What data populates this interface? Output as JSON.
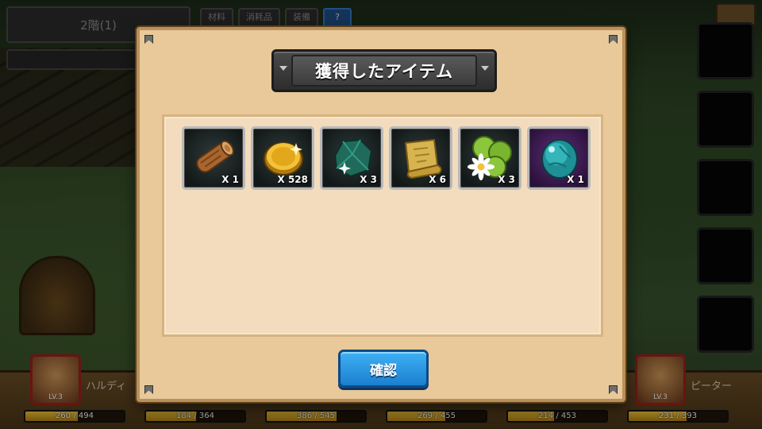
{
  "background": {
    "floor_label": "2階(1)",
    "tabs": [
      "材料",
      "消耗品",
      "装備",
      "?"
    ],
    "heroes": [
      {
        "name": "ハルディ",
        "level": "LV.3"
      },
      {
        "name": "ピーター",
        "level": "LV.3"
      }
    ],
    "hp_bars": [
      {
        "text": "260 / 494",
        "fill": 0.53
      },
      {
        "text": "184 / 364",
        "fill": 0.51
      },
      {
        "text": "386 / 545",
        "fill": 0.71
      },
      {
        "text": "269 / 455",
        "fill": 0.59
      },
      {
        "text": "214 / 453",
        "fill": 0.47
      },
      {
        "text": "231 / 393",
        "fill": 0.59
      }
    ]
  },
  "dialog": {
    "title": "獲得したアイテム",
    "items": [
      {
        "icon": "wood-log-icon",
        "quantity": "X 1"
      },
      {
        "icon": "gold-coin-icon",
        "quantity": "X 528"
      },
      {
        "icon": "green-crystal-ore-icon",
        "quantity": "X 3"
      },
      {
        "icon": "parchment-scroll-icon",
        "quantity": "X 6"
      },
      {
        "icon": "daisy-leaf-icon",
        "quantity": "X 3"
      },
      {
        "icon": "teal-egg-gem-icon",
        "quantity": "X 1"
      }
    ],
    "confirm_label": "確認"
  },
  "colors": {
    "dialog_bg": "#e9c999",
    "panel_bg": "#f3dcbd",
    "button_blue": "#1b7fd0",
    "hp_gold": "#f0c43a",
    "hero_border_red": "#a0201c"
  }
}
